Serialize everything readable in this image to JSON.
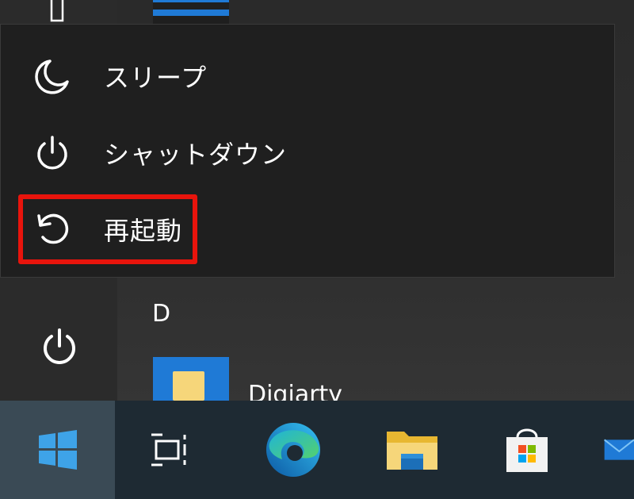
{
  "power_menu": {
    "items": [
      {
        "label": "スリープ",
        "icon": "moon-icon"
      },
      {
        "label": "シャットダウン",
        "icon": "power-icon"
      },
      {
        "label": "再起動",
        "icon": "restart-icon"
      }
    ],
    "highlight_color": "#e8140c"
  },
  "app_list": {
    "section_letter": "D",
    "entry_name": "Digiarty"
  },
  "taskbar": {
    "items": [
      "windows-start-icon",
      "task-view-icon",
      "edge-icon",
      "file-explorer-icon",
      "store-icon",
      "mail-icon"
    ]
  },
  "colors": {
    "accent": "#1f7ad6",
    "taskbar": "#1e2a33"
  }
}
